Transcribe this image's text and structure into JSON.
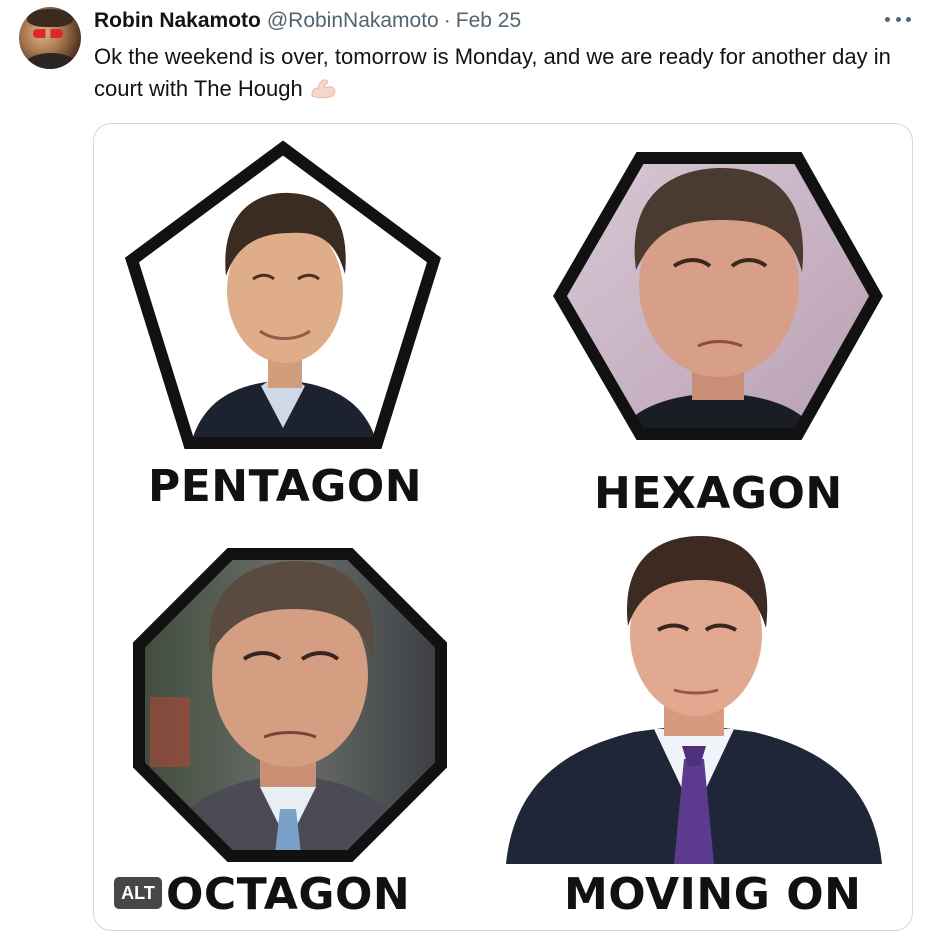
{
  "tweet": {
    "author_name": "Robin Nakamoto",
    "handle": "@RobinNakamoto",
    "separator": "·",
    "date": "Feb 25",
    "text": "Ok the weekend is over, tomorrow is Monday, and we are ready for another day in court with The Hough",
    "emoji": "flexed-biceps-icon"
  },
  "media": {
    "alt_badge": "ALT",
    "panels": [
      {
        "label": "PENTAGON",
        "shape": "pentagon"
      },
      {
        "label": "HEXAGON",
        "shape": "hexagon"
      },
      {
        "label": "OCTAGON",
        "shape": "octagon"
      },
      {
        "label": "MOVING ON",
        "shape": "none"
      }
    ]
  },
  "colors": {
    "text": "#0f1419",
    "secondary_text": "#536471",
    "card_border": "#cfd9de",
    "shape_border": "#111111",
    "tie_purple": "#5c3a8e"
  }
}
